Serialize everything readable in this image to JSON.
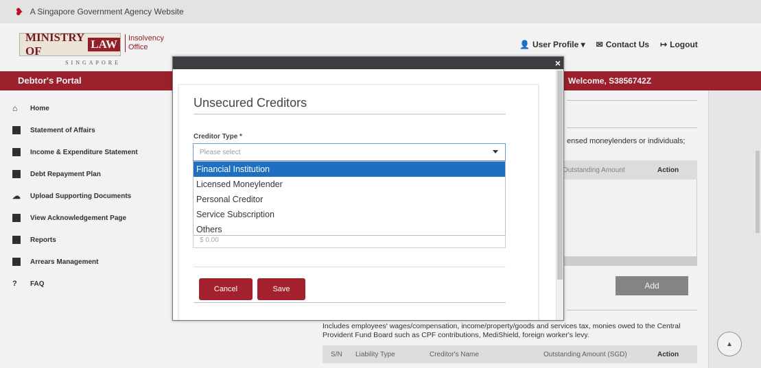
{
  "gov_banner": {
    "text": "A Singapore Government Agency Website"
  },
  "logo": {
    "ministry": "MINISTRY OF",
    "law": "LAW",
    "country": "SINGAPORE",
    "sub": "Insolvency Office"
  },
  "header_links": {
    "profile": "User Profile ▾",
    "contact": "Contact Us",
    "logout": "Logout"
  },
  "portal": {
    "title": "Debtor's Portal",
    "welcome": "Welcome, S3856742Z"
  },
  "sidebar": {
    "items": [
      {
        "label": "Home",
        "icon": "home-icon"
      },
      {
        "label": "Statement of Affairs",
        "icon": "document-icon"
      },
      {
        "label": "Income & Expenditure Statement",
        "icon": "book-icon"
      },
      {
        "label": "Debt Repayment Plan",
        "icon": "plan-icon"
      },
      {
        "label": "Upload Supporting Documents",
        "icon": "cloud-upload-icon"
      },
      {
        "label": "View Acknowledgement Page",
        "icon": "acknowledgement-icon"
      },
      {
        "label": "Reports",
        "icon": "book-icon"
      },
      {
        "label": "Arrears Management",
        "icon": "arrears-icon"
      },
      {
        "label": "FAQ",
        "icon": "question-icon"
      }
    ]
  },
  "background": {
    "creditor_note": "ensed moneylenders or individuals;",
    "table1_outstanding": "Outstanding Amount",
    "table1_action": "Action",
    "add_label": "Add",
    "preferential_note": "Includes employees' wages/compensation, income/property/goods and services tax, monies owed to the Central Provident Fund Board such as CPF contributions, MediShield, foreign worker's levy.",
    "table2_headers": [
      "S/N",
      "Liability Type",
      "Creditor's Name",
      "Outstanding Amount (SGD)",
      "Action"
    ]
  },
  "modal": {
    "close_label": "×",
    "title": "Unsecured Creditors",
    "creditor_type_label": "Creditor Type *",
    "select_placeholder": "Please select",
    "options": [
      "Financial Institution",
      "Licensed Moneylender",
      "Personal Creditor",
      "Service Subscription",
      "Others"
    ],
    "active_option_index": 0,
    "amount_placeholder": "$ 0.00",
    "cancel_label": "Cancel",
    "save_label": "Save"
  },
  "colors": {
    "brand_red": "#a3222e",
    "dropdown_highlight": "#1e6fc0"
  }
}
